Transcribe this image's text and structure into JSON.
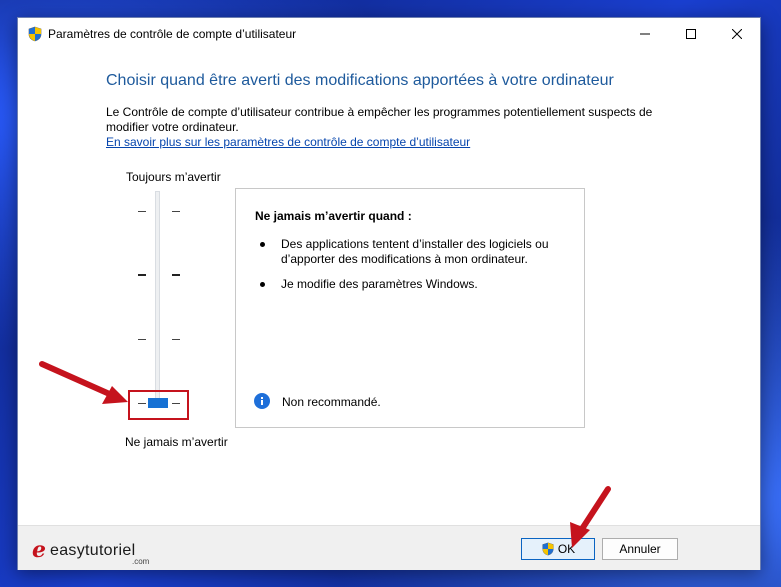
{
  "window": {
    "title": "Paramètres de contrôle de compte d’utilisateur",
    "controls": {
      "minimize": "minimize-icon",
      "maximize": "maximize-icon",
      "close": "close-icon"
    }
  },
  "main": {
    "heading": "Choisir quand être averti des modifications apportées à votre ordinateur",
    "description": "Le Contrôle de compte d’utilisateur contribue à empêcher les programmes potentiellement suspects de modifier votre ordinateur.",
    "link": "En savoir plus sur les paramètres de contrôle de compte d’utilisateur"
  },
  "slider": {
    "top_label": "Toujours m’avertir",
    "bottom_label": "Ne jamais m’avertir",
    "levels": 4,
    "selected_level": 1
  },
  "info": {
    "title": "Ne jamais m’avertir quand :",
    "bullets": [
      "Des applications tentent d’installer des logiciels ou d’apporter des modifications à mon ordinateur.",
      "Je modifie des paramètres Windows."
    ],
    "recommendation": "Non recommandé."
  },
  "footer": {
    "ok_label": "OK",
    "cancel_label": "Annuler",
    "brand_name": "easytutoriel",
    "brand_suffix": ".com"
  },
  "colors": {
    "heading": "#1e5a9c",
    "link": "#0645ad",
    "accent": "#1671d4",
    "annotation": "#c5131d"
  }
}
